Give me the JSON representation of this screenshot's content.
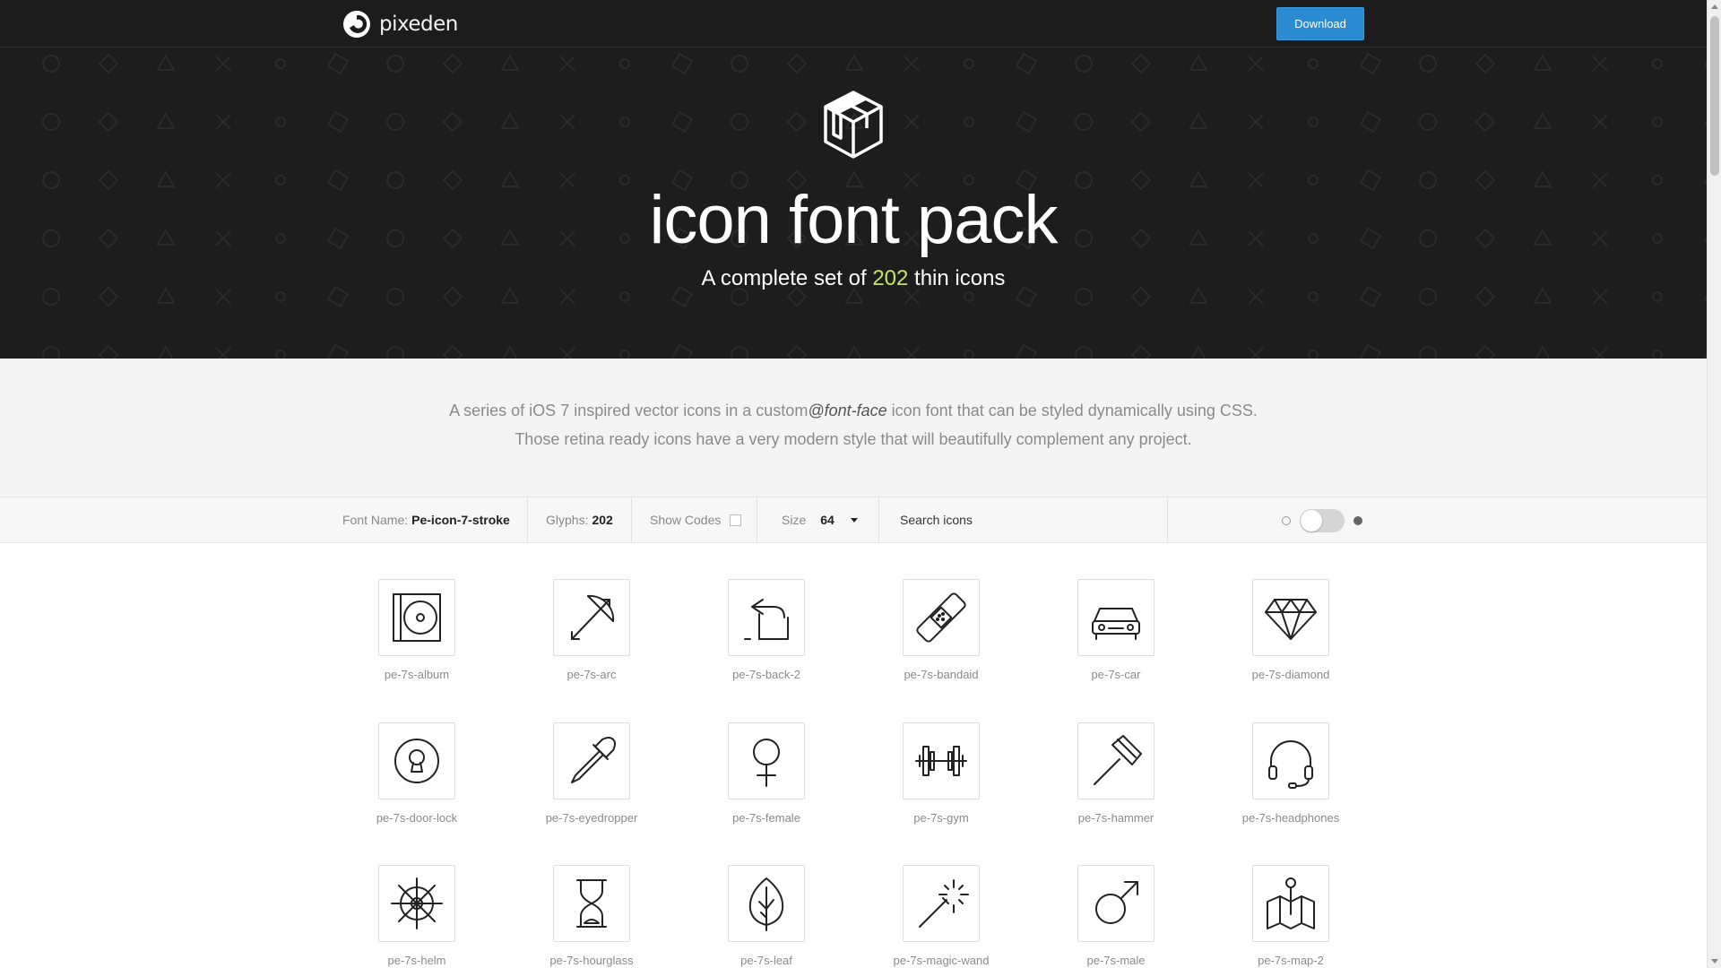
{
  "nav": {
    "logo_text": "pixeden",
    "download_label": "Download"
  },
  "hero": {
    "title": "icon font pack",
    "subtitle_before": "A complete set of ",
    "subtitle_count": "202",
    "subtitle_after": " thin icons",
    "accent_color": "#c9e265"
  },
  "description": {
    "line1_before": "A series of iOS 7 inspired vector icons in a custom",
    "line1_em": "@font-face",
    "line1_after": " icon font that can be styled dynamically using CSS.",
    "line2": "Those retina ready icons have a very modern style that will beautifully complement any project."
  },
  "toolbar": {
    "font_name_label": "Font Name:",
    "font_name_value": "Pe-icon-7-stroke",
    "glyphs_label": "Glyphs:",
    "glyphs_value": "202",
    "show_codes_label": "Show Codes",
    "size_label": "Size",
    "size_value": "64",
    "search_placeholder": "Search icons"
  },
  "icons": [
    {
      "name": "pe-7s-album",
      "icon": "album-icon"
    },
    {
      "name": "pe-7s-arc",
      "icon": "arc-icon"
    },
    {
      "name": "pe-7s-back-2",
      "icon": "back-2-icon"
    },
    {
      "name": "pe-7s-bandaid",
      "icon": "bandaid-icon"
    },
    {
      "name": "pe-7s-car",
      "icon": "car-icon"
    },
    {
      "name": "pe-7s-diamond",
      "icon": "diamond-icon"
    },
    {
      "name": "pe-7s-door-lock",
      "icon": "door-lock-icon"
    },
    {
      "name": "pe-7s-eyedropper",
      "icon": "eyedropper-icon"
    },
    {
      "name": "pe-7s-female",
      "icon": "female-icon"
    },
    {
      "name": "pe-7s-gym",
      "icon": "gym-icon"
    },
    {
      "name": "pe-7s-hammer",
      "icon": "hammer-icon"
    },
    {
      "name": "pe-7s-headphones",
      "icon": "headphones-icon"
    },
    {
      "name": "pe-7s-helm",
      "icon": "helm-icon"
    },
    {
      "name": "pe-7s-hourglass",
      "icon": "hourglass-icon"
    },
    {
      "name": "pe-7s-leaf",
      "icon": "leaf-icon"
    },
    {
      "name": "pe-7s-magic-wand",
      "icon": "magic-wand-icon"
    },
    {
      "name": "pe-7s-male",
      "icon": "male-icon"
    },
    {
      "name": "pe-7s-map-2",
      "icon": "map-2-icon"
    }
  ]
}
